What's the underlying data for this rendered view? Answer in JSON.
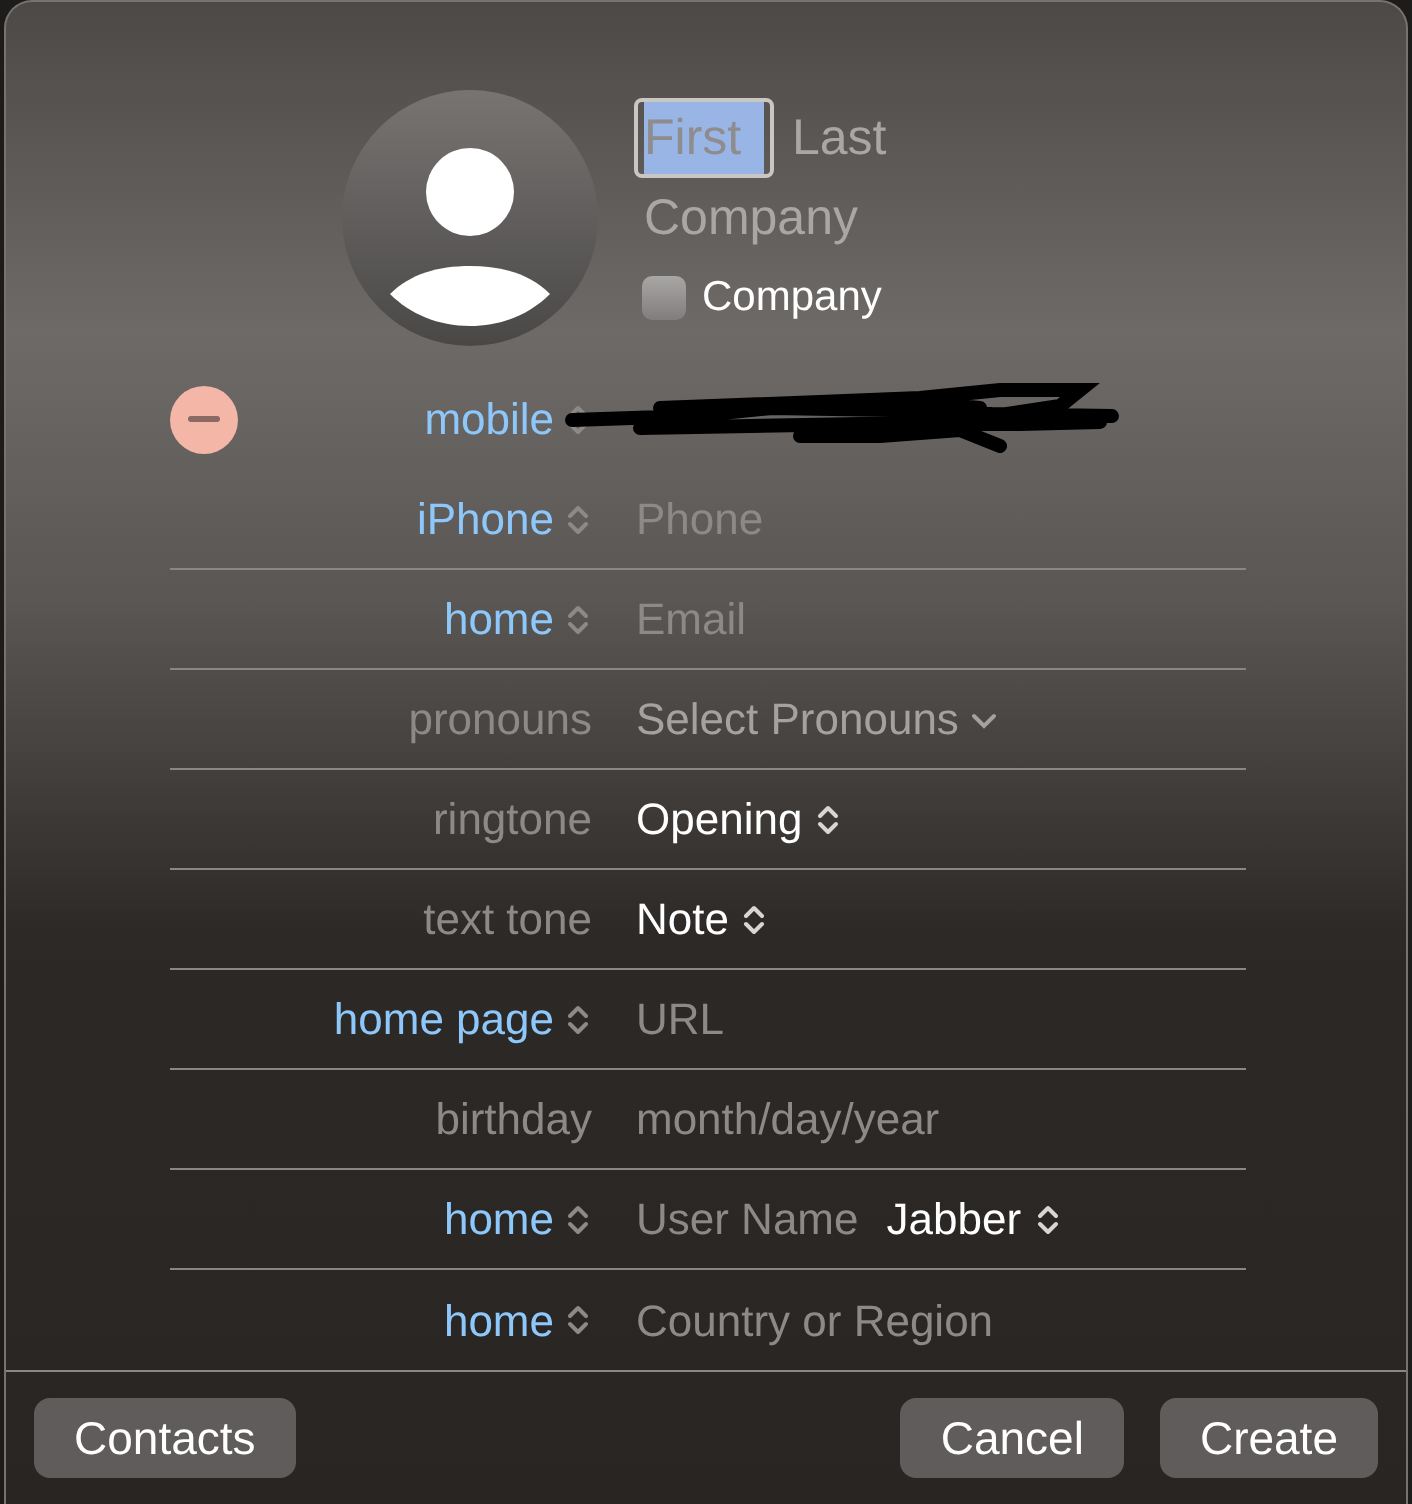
{
  "header": {
    "first_name": {
      "placeholder": "First",
      "focused": true
    },
    "last_name": {
      "placeholder": "Last"
    },
    "company": {
      "placeholder": "Company"
    },
    "company_checkbox": {
      "label": "Company",
      "checked": false
    }
  },
  "rows": [
    {
      "label": "mobile",
      "label_popup": true,
      "kind": "redacted",
      "removable": true
    },
    {
      "label": "iPhone",
      "label_popup": true,
      "kind": "input",
      "placeholder": "Phone",
      "removable": false
    },
    {
      "label": "home",
      "label_popup": true,
      "kind": "input",
      "placeholder": "Email",
      "removable": false
    },
    {
      "label": "pronouns",
      "label_popup": false,
      "kind": "menu",
      "value": "Select Pronouns",
      "removable": false
    },
    {
      "label": "ringtone",
      "label_popup": false,
      "kind": "stepper",
      "value": "Opening",
      "removable": false
    },
    {
      "label": "text tone",
      "label_popup": false,
      "kind": "stepper",
      "value": "Note",
      "removable": false
    },
    {
      "label": "home page",
      "label_popup": true,
      "kind": "input",
      "placeholder": "URL",
      "removable": false
    },
    {
      "label": "birthday",
      "label_popup": false,
      "kind": "input",
      "placeholder": "month/day/year",
      "removable": false
    },
    {
      "label": "home",
      "label_popup": true,
      "kind": "input",
      "placeholder": "User Name",
      "service": "Jabber",
      "removable": false
    },
    {
      "label": "home",
      "label_popup": true,
      "kind": "input",
      "placeholder": "Country or Region",
      "removable": false
    }
  ],
  "footer": {
    "left_button": "Contacts",
    "buttons": [
      "Cancel",
      "Create"
    ]
  }
}
